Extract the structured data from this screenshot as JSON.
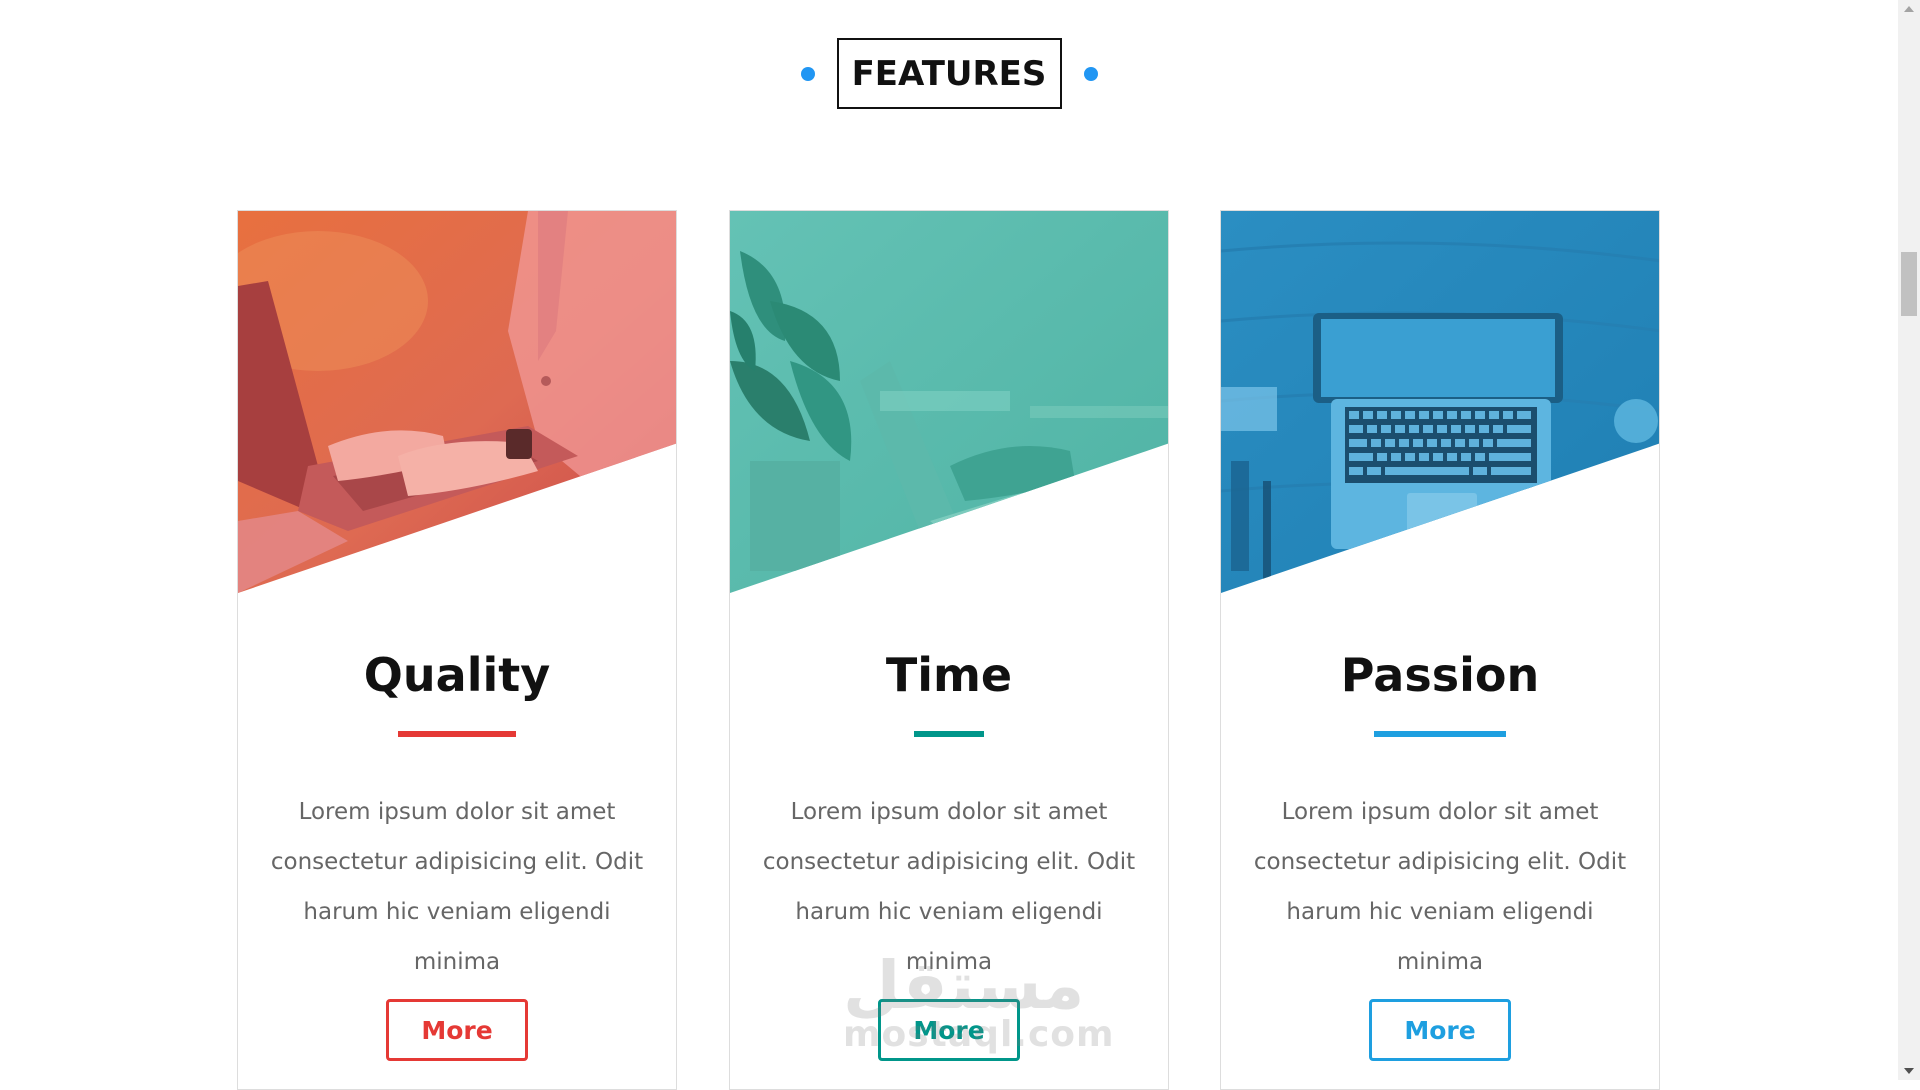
{
  "section": {
    "title": "FEATURES",
    "accent_color": "#2196f3"
  },
  "cards": [
    {
      "title": "Quality",
      "text": "Lorem ipsum dolor sit amet consectetur adipisicing elit. Odit harum hic veniam eligendi minima",
      "button_label": "More",
      "accent_color": "#e53935",
      "image_icon": "laptop-photo-red-tint"
    },
    {
      "title": "Time",
      "text": "Lorem ipsum dolor sit amet consectetur adipisicing elit. Odit harum hic veniam eligendi minima",
      "button_label": "More",
      "accent_color": "#00968a",
      "image_icon": "laptop-photo-teal-tint"
    },
    {
      "title": "Passion",
      "text": "Lorem ipsum dolor sit amet consectetur adipisicing elit. Odit harum hic veniam eligendi minima",
      "button_label": "More",
      "accent_color": "#1e9fe0",
      "image_icon": "laptop-photo-blue-tint"
    }
  ],
  "watermark": {
    "arabic": "مستقل",
    "latin": "mostaql.com"
  }
}
